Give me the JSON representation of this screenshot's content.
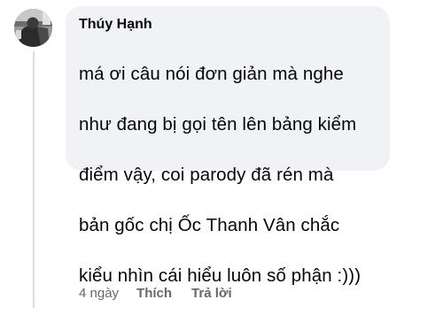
{
  "comment": {
    "author": "Thúy Hạnh",
    "lines": [
      "má ơi câu nói đơn giản mà nghe",
      "như đang bị gọi tên lên bảng kiểm",
      "điểm vậy, coi parody đã rén mà",
      "bản gốc chị Ốc Thanh Vân chắc",
      "kiểu nhìn cái hiểu luôn số phận :)))"
    ],
    "timestamp": "4 ngày",
    "like_label": "Thích",
    "reply_label": "Trả lời"
  },
  "colors": {
    "bubble_bg": "#f0f2f5",
    "text": "#050505",
    "secondary_text": "#65676b",
    "thread_line": "#dadde1"
  },
  "icons": {
    "avatar": "user-profile-photo"
  }
}
